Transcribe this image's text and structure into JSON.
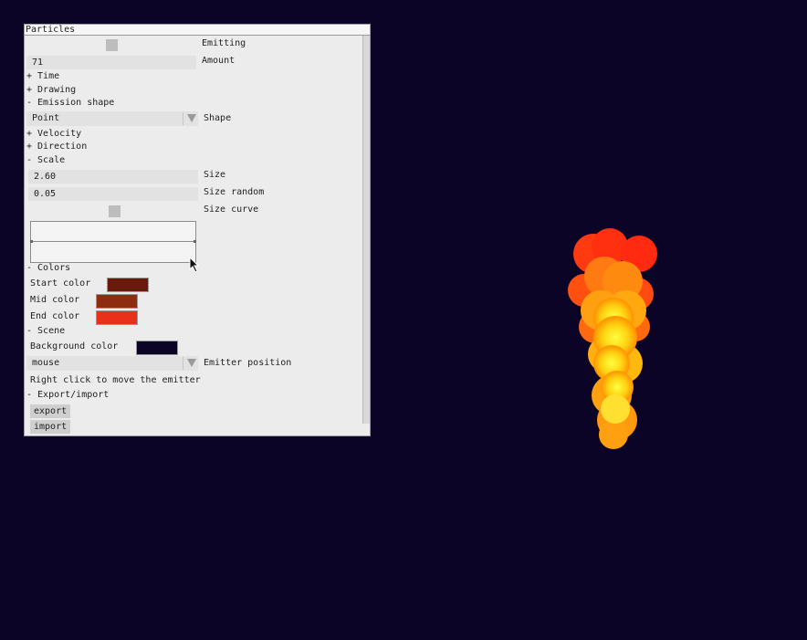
{
  "window": {
    "title": "Particles"
  },
  "emitting": {
    "label": "Emitting"
  },
  "amount": {
    "value": "71",
    "label": "Amount"
  },
  "sections": {
    "time": "+ Time",
    "drawing": "+ Drawing",
    "emission_shape": "- Emission shape",
    "velocity": "+ Velocity",
    "direction": "+ Direction",
    "scale": "- Scale",
    "colors": "- Colors",
    "scene": "- Scene",
    "export_import": "- Export/import"
  },
  "shape": {
    "value": "Point",
    "label": "Shape"
  },
  "size": {
    "value": "2.60",
    "label": "Size"
  },
  "size_random": {
    "value": "0.05",
    "label": "Size random"
  },
  "size_curve": {
    "label": "Size curve"
  },
  "colors": {
    "start": {
      "label": "Start color",
      "color": "#6a1a0c"
    },
    "mid": {
      "label": "Mid color",
      "color": "#8e2c10"
    },
    "end": {
      "label": "End color",
      "color": "#e8301a"
    }
  },
  "scene": {
    "background_label": "Background color",
    "background_color": "#0c0426",
    "emitter_position_value": "mouse",
    "emitter_position_label": "Emitter position",
    "hint": "Right click to move the emitter"
  },
  "buttons": {
    "export": "export",
    "import": "import"
  },
  "icons": {
    "dropdown": "dropdown-arrow-icon",
    "cursor": "mouse-pointer-icon"
  }
}
